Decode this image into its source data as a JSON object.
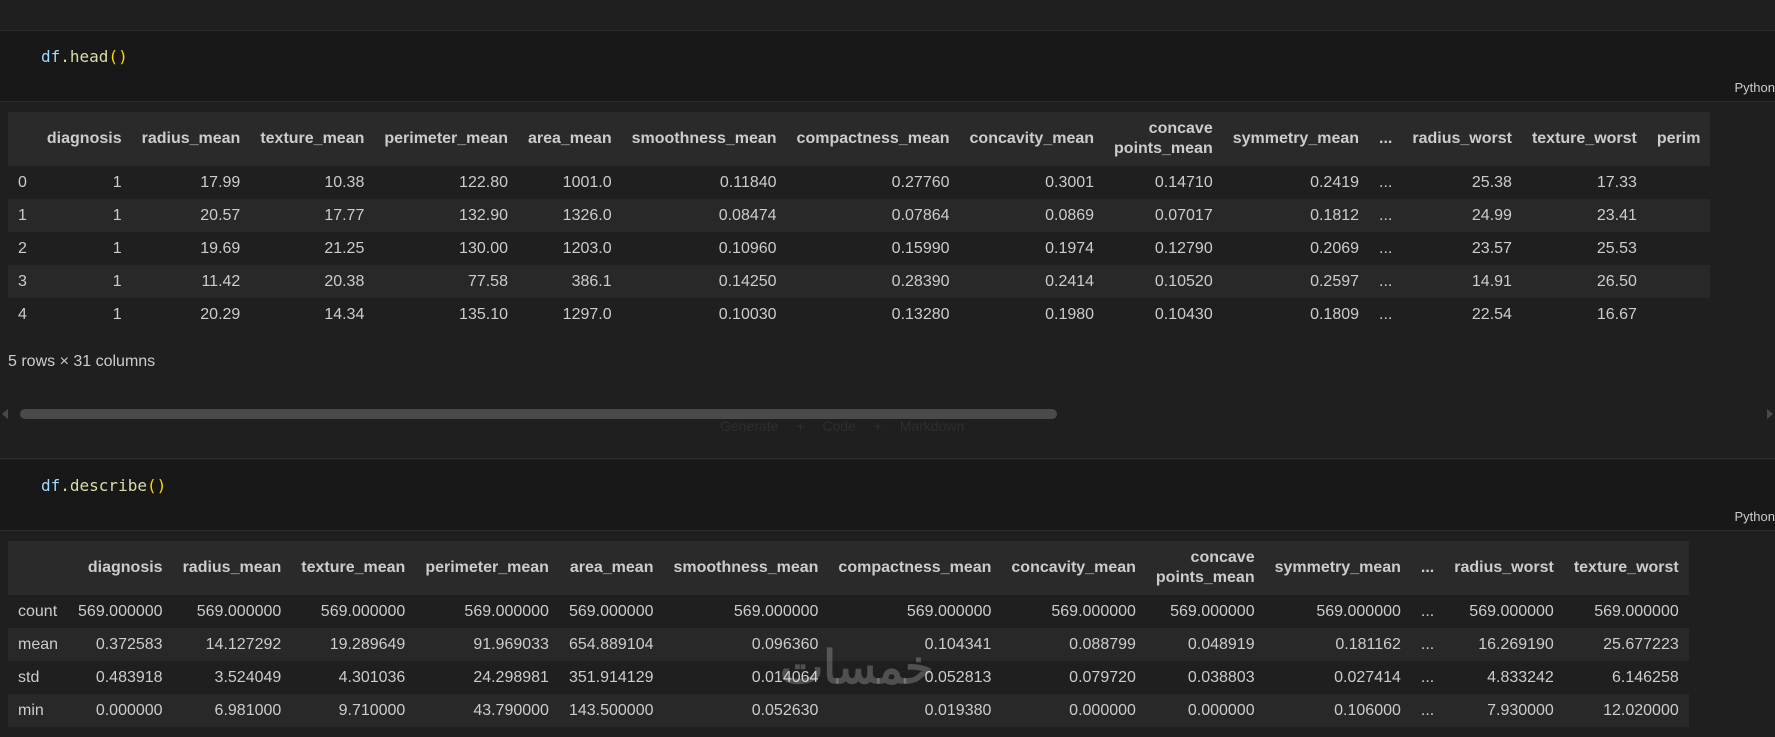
{
  "cell1": {
    "code_obj": "df",
    "code_method": ".head",
    "code_parens": "()",
    "language": "Python"
  },
  "head_table": {
    "columns": [
      "diagnosis",
      "radius_mean",
      "texture_mean",
      "perimeter_mean",
      "area_mean",
      "smoothness_mean",
      "compactness_mean",
      "concavity_mean",
      "concave points_mean",
      "symmetry_mean",
      "...",
      "radius_worst",
      "texture_worst",
      "perim"
    ],
    "rows": [
      {
        "index": "0",
        "values": [
          "1",
          "17.99",
          "10.38",
          "122.80",
          "1001.0",
          "0.11840",
          "0.27760",
          "0.3001",
          "0.14710",
          "0.2419",
          "...",
          "25.38",
          "17.33",
          ""
        ]
      },
      {
        "index": "1",
        "values": [
          "1",
          "20.57",
          "17.77",
          "132.90",
          "1326.0",
          "0.08474",
          "0.07864",
          "0.0869",
          "0.07017",
          "0.1812",
          "...",
          "24.99",
          "23.41",
          ""
        ]
      },
      {
        "index": "2",
        "values": [
          "1",
          "19.69",
          "21.25",
          "130.00",
          "1203.0",
          "0.10960",
          "0.15990",
          "0.1974",
          "0.12790",
          "0.2069",
          "...",
          "23.57",
          "25.53",
          ""
        ]
      },
      {
        "index": "3",
        "values": [
          "1",
          "11.42",
          "20.38",
          "77.58",
          "386.1",
          "0.14250",
          "0.28390",
          "0.2414",
          "0.10520",
          "0.2597",
          "...",
          "14.91",
          "26.50",
          ""
        ]
      },
      {
        "index": "4",
        "values": [
          "1",
          "20.29",
          "14.34",
          "135.10",
          "1297.0",
          "0.10030",
          "0.13280",
          "0.1980",
          "0.10430",
          "0.1809",
          "...",
          "22.54",
          "16.67",
          ""
        ]
      }
    ],
    "shape_text": "5 rows × 31 columns"
  },
  "cell2": {
    "code_obj": "df",
    "code_method": ".describe",
    "code_parens": "()",
    "language": "Python"
  },
  "describe_table": {
    "columns": [
      "diagnosis",
      "radius_mean",
      "texture_mean",
      "perimeter_mean",
      "area_mean",
      "smoothness_mean",
      "compactness_mean",
      "concavity_mean",
      "concave points_mean",
      "symmetry_mean",
      "...",
      "radius_worst",
      "texture_worst"
    ],
    "rows": [
      {
        "index": "count",
        "values": [
          "569.000000",
          "569.000000",
          "569.000000",
          "569.000000",
          "569.000000",
          "569.000000",
          "569.000000",
          "569.000000",
          "569.000000",
          "569.000000",
          "...",
          "569.000000",
          "569.000000"
        ]
      },
      {
        "index": "mean",
        "values": [
          "0.372583",
          "14.127292",
          "19.289649",
          "91.969033",
          "654.889104",
          "0.096360",
          "0.104341",
          "0.088799",
          "0.048919",
          "0.181162",
          "...",
          "16.269190",
          "25.677223"
        ]
      },
      {
        "index": "std",
        "values": [
          "0.483918",
          "3.524049",
          "4.301036",
          "24.298981",
          "351.914129",
          "0.014064",
          "0.052813",
          "0.079720",
          "0.038803",
          "0.027414",
          "...",
          "4.833242",
          "6.146258"
        ]
      },
      {
        "index": "min",
        "values": [
          "0.000000",
          "6.981000",
          "9.710000",
          "43.790000",
          "143.500000",
          "0.052630",
          "0.019380",
          "0.000000",
          "0.000000",
          "0.106000",
          "...",
          "7.930000",
          "12.020000"
        ]
      }
    ]
  },
  "toolbar_faint": "Generate  + Code  + Markdown",
  "watermark": "خمسات"
}
